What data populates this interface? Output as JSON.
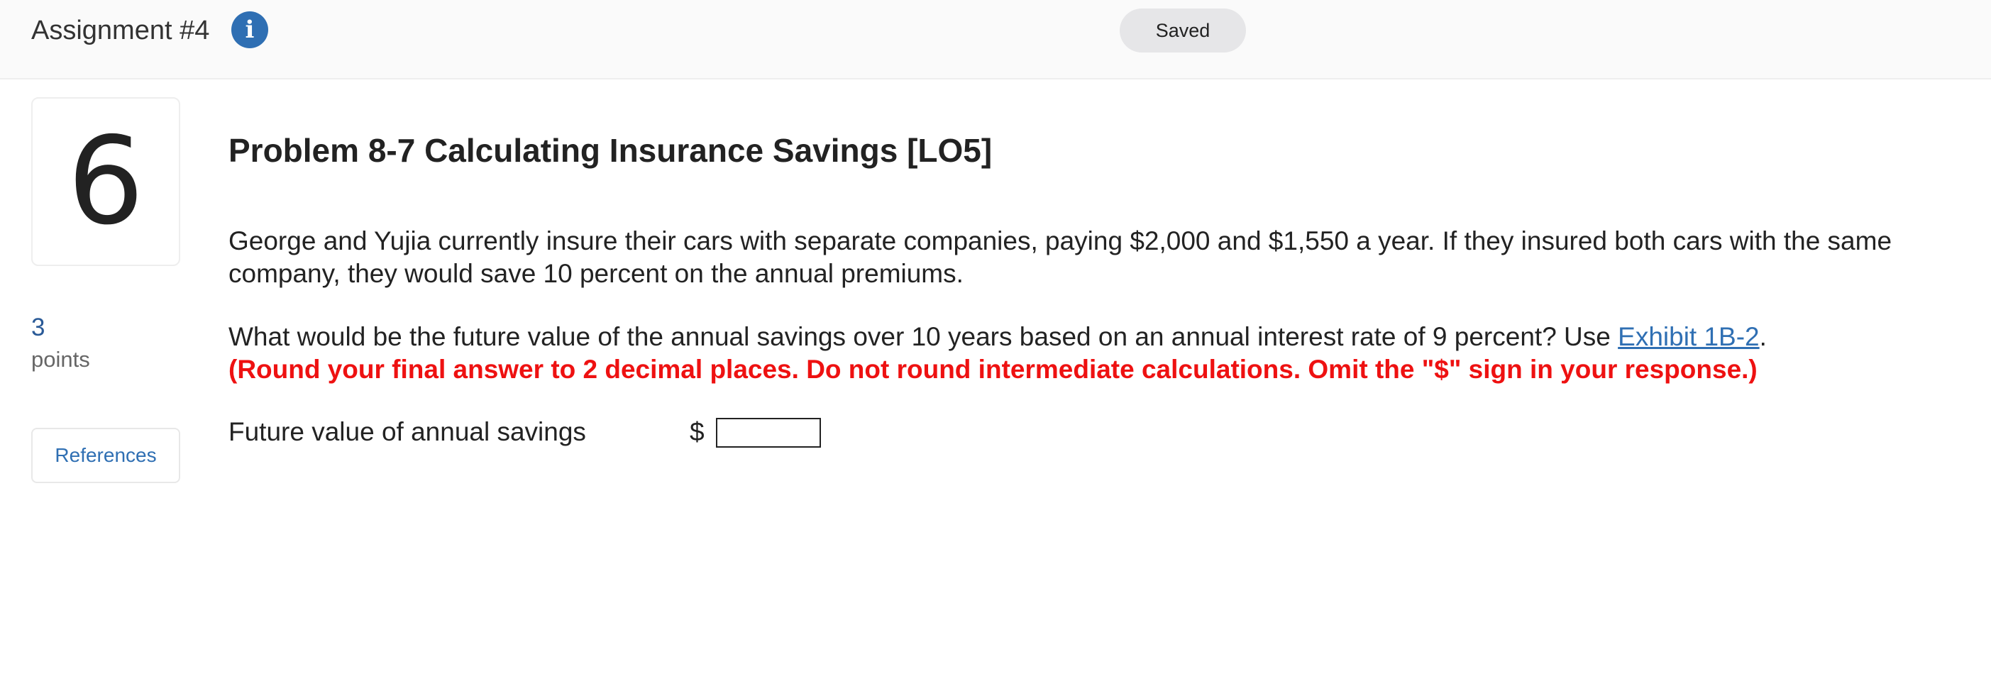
{
  "header": {
    "assignment_title": "Assignment #4",
    "info_icon": "info-icon",
    "status": "Saved"
  },
  "sidebar": {
    "question_number": "6",
    "points_value": "3",
    "points_label": "points",
    "references_label": "References"
  },
  "problem": {
    "title": "Problem 8-7 Calculating Insurance Savings [LO5]",
    "paragraph1": "George and Yujia currently insure their cars with separate companies, paying $2,000 and $1,550 a year. If they insured both cars with the same company, they would save 10 percent on the annual premiums.",
    "question_text": "What would be the future value of the annual savings over 10 years based on an annual interest rate of 9 percent? Use ",
    "exhibit_link": "Exhibit 1B-2",
    "question_end": ".",
    "instruction": "(Round your final answer to 2 decimal places. Do not round intermediate calculations. Omit the \"$\" sign in your response.)",
    "answer_label": "Future value of annual savings",
    "currency_symbol": "$",
    "answer_value": ""
  },
  "colors": {
    "accent_blue": "#2f6fb3",
    "instruction_red": "#ee1111",
    "badge_gray": "#e6e6e8"
  }
}
